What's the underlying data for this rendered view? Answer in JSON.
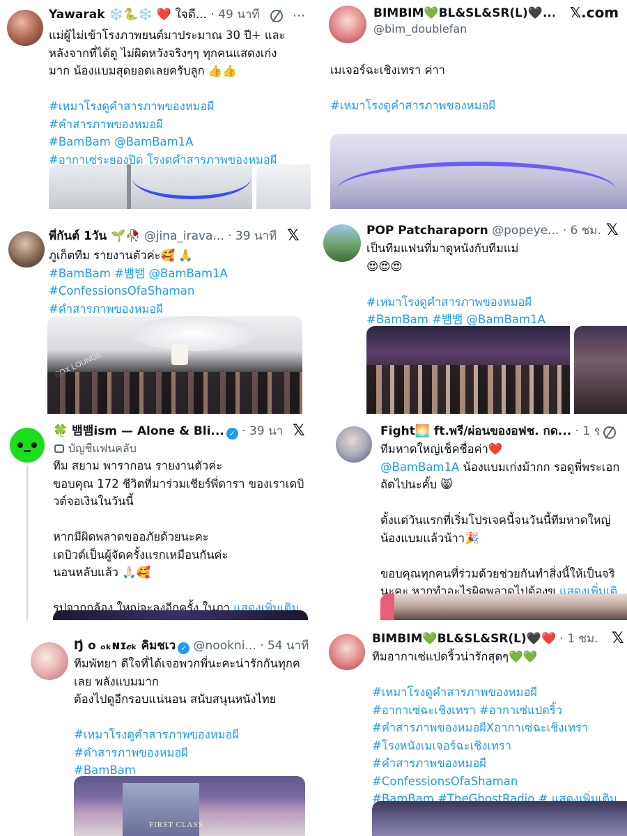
{
  "tweets": {
    "t1": {
      "name": "Yawarak",
      "name_suffix": " ❄️🐍❄️ ❤️ ใจดี...",
      "time": " · 49 นาที",
      "lines": [
        "แม่ผู้ไม่เข้าโรงภาพยนต์มาประมาณ 30 ปี+  และ",
        "หลังจากที่ได้ดู ไม่ผิดหวังจริงๆๆ  ทุกคนแสดงเก่ง",
        "มาก น้องแบมสุดยอดเลยครับลูก 👍👍"
      ],
      "hashtags": [
        "#เหมาโรงดูคำสารภาพของหมอผี",
        "#คำสารภาพของหมอผี",
        "#BamBam @BamBam1A",
        "#อากาเซ่ระยองปิด โรงดูคำสารภาพของหมอผี"
      ]
    },
    "t2": {
      "name": "BIMBIM💚BL&SL&SR(L)🖤...",
      "handle": "@bim_doublefan",
      "x_label": "𝕏.com",
      "text": "เมเจอร์ฉะเชิงเทรา ค่าา",
      "hashtag": "#เหมาโรงดูคำสารภาพของหมอผี"
    },
    "t3": {
      "name": "พี่กันต์ 1วัน 🌱🥀",
      "meta": " @jina_irava... · 39 นาที",
      "line1": "ภูเก็ตทีม รายงานตัวค่ะ🥰 🙏",
      "hashtags": [
        "#BamBam #뱀뱀 @BamBam1A",
        "#ConfessionsOfaShaman",
        "#คำสารภาพของหมอผี"
      ],
      "image_caption": "BOX LOUNGE"
    },
    "t4": {
      "name": "POP Patcharaporn",
      "meta": " @popeye... · 6 ชม.",
      "line1": "เป็นทีมแฟนที่มาดูหนังกับทีมแม่",
      "line2": "😍😍😍",
      "hashtags": [
        "#เหมาโรงดูคำสารภาพของหมอผี",
        "#BamBam #뱀뱀 @BamBam1A"
      ]
    },
    "t5": {
      "name": "🍀 뱀뱀ism — Alone & Bli...",
      "meta": " · 39 นาที",
      "fan_label": "บัญชีแฟนคลับ",
      "lines": [
        "ทีม สยาม พารากอน รายงานตัวค่ะ",
        "ขอบคุณ 172 ชีวิตที่มาร่วมเชียร์พี่ดารา ของเราเดบิ",
        "วต์จอเงินในวันนี้",
        "",
        "หากมีผิดพลาดขออภัยด้วยนะคะ",
        "เดบิวต์เป็นผู้จัดครั้งแรกเหมือนกันค่ะ",
        "นอนหลับแล้ว 🙏🏻🥰",
        ""
      ],
      "last_line": "รูปจากกล้อง ใหญ่จะลงอีกครั้ง ในภา ",
      "show_more": "แสดงเพิ่มเติม"
    },
    "t6": {
      "name": "Fight🌅 ft.พรี/ผ่อนของอฟช. กด...",
      "meta": " · 1 ชม.",
      "lines": [
        "ทีมหาดใหญ่เช็คชื่อค่า❤️",
        "@BamBam1A น้องแบมเก่งม้ากก รอดูพี่พระเอก",
        "ถัดไปนะคั้บ 😸",
        "",
        "ตั้งแต่วันแรกที่เริ่มโปรเจคนี้จนวันนี้ทีมหาดใหญ่",
        "น้องแบมแล้วน้าา🎉",
        "",
        "ขอบคุณทุกคนที่ร่วมด้วยช่วยกันทำสิ่งนี้ให้เป็นจริ"
      ],
      "last_line": "นะคะ หากทำอะไรผิดพลาดไปต้องข ",
      "show_more": "แสดงเพิ่มเติ"
    },
    "t7": {
      "name": "Ŋ̍ o ₒₖɴɪ𝒸ₖ คิมชเว",
      "meta": " @nookni... · 54 นาที",
      "lines": [
        "ทีมพัทยา  ดีใจที่ได้เจอพวกพี่นะคะน่ารักกันทุกค",
        "เลย  พลังแบมมาก",
        "ต้องไปดูอีกรอบแน่นอน  สนับสนุนหนังไทย"
      ],
      "hashtags": [
        "#เหมาโรงดูคำสารภาพของหมอผี",
        "#คำสารภาพของหมอผี",
        "#BamBam"
      ],
      "image_caption": "FIRST CLASS"
    },
    "t8": {
      "name": "BIMBIM💚BL&SL&SR(L)🖤❤️",
      "meta": " · 1 ชม.",
      "line1": "ทีมอากาเซ่แปดริ้วน่ารักสุดๆ💚💚",
      "hashtags": [
        "#เหมาโรงดูคำสารภาพของหมอผี",
        "#อากาเซ่ฉะเชิงเทรา #อากาเซ่แปดริ้ว",
        "#คำสารภาพของหมอผีXอากาเซ่ฉะเชิงเทรา",
        "#โรงหนังเมเจอร์ฉะเชิงเทรา",
        "#คำสารภาพของหมอผี",
        "#ConfessionsOfaShaman"
      ],
      "last_tags": "#BamBam #TheGhostRadio # ",
      "show_more": "แสดงเพิ่มเติม"
    }
  },
  "x_icon": "𝕏",
  "verified_mark": "✓",
  "colors": {
    "link": "#1d9bf0",
    "text": "#0f1419",
    "meta": "#536471"
  }
}
